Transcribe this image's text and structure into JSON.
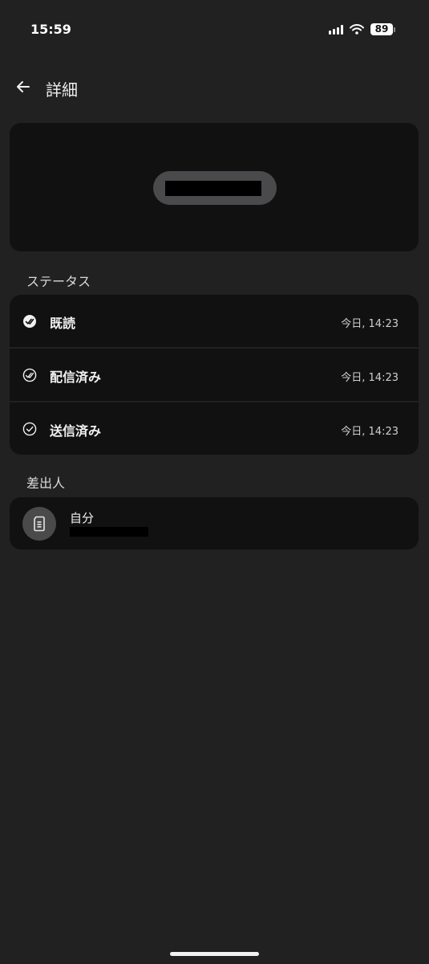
{
  "status_bar": {
    "time": "15:59",
    "battery": "89",
    "icons": [
      "cellular-signal-icon",
      "wifi-icon",
      "battery-icon"
    ]
  },
  "header": {
    "title": "詳細",
    "back_icon": "arrow-left-icon"
  },
  "message_preview": {
    "content_redacted": true
  },
  "status_section": {
    "label": "ステータス",
    "items": [
      {
        "label": "既読",
        "time": "今日, 14:23",
        "icon": "double-check-filled-icon"
      },
      {
        "label": "配信済み",
        "time": "今日, 14:23",
        "icon": "double-check-outline-icon"
      },
      {
        "label": "送信済み",
        "time": "今日, 14:23",
        "icon": "check-outline-icon"
      }
    ]
  },
  "sender_section": {
    "label": "差出人",
    "name": "自分",
    "avatar_icon": "sim-card-icon"
  },
  "colors": {
    "background": "#212121",
    "card": "#111111",
    "bubble": "#4a4a4c"
  }
}
